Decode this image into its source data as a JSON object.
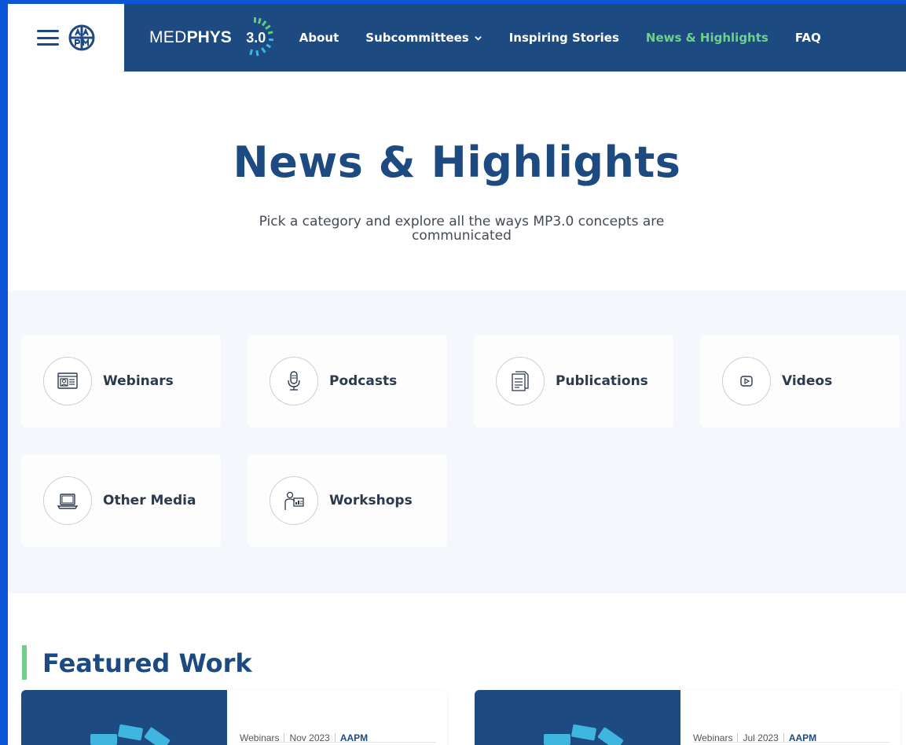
{
  "header": {
    "brand_med": "MED",
    "brand_phys": "PHYS",
    "brand_version": "3.0",
    "nav": [
      {
        "label": "About"
      },
      {
        "label": "Subcommittees"
      },
      {
        "label": "Inspiring Stories"
      },
      {
        "label": "News & Highlights",
        "active": true
      },
      {
        "label": "FAQ"
      }
    ]
  },
  "hero": {
    "title": "News & Highlights",
    "subtitle": "Pick a category and explore all the ways MP3.0 concepts are communicated"
  },
  "categories": [
    {
      "label": "Webinars",
      "icon": "webinar-icon"
    },
    {
      "label": "Podcasts",
      "icon": "microphone-icon"
    },
    {
      "label": "Publications",
      "icon": "document-icon"
    },
    {
      "label": "Videos",
      "icon": "play-icon"
    },
    {
      "label": "Other Media",
      "icon": "laptop-icon"
    },
    {
      "label": "Workshops",
      "icon": "presenter-icon"
    }
  ],
  "featured": {
    "title": "Featured Work",
    "items": [
      {
        "category": "Webinars",
        "date": "Nov 2023",
        "org": "AAPM"
      },
      {
        "category": "Webinars",
        "date": "Jul 2023",
        "org": "AAPM"
      }
    ]
  },
  "colors": {
    "primary": "#1e4a82",
    "accent_green": "#6fd08e",
    "band_bg": "#f4f8fc",
    "outer_bg": "#0b55d6"
  }
}
